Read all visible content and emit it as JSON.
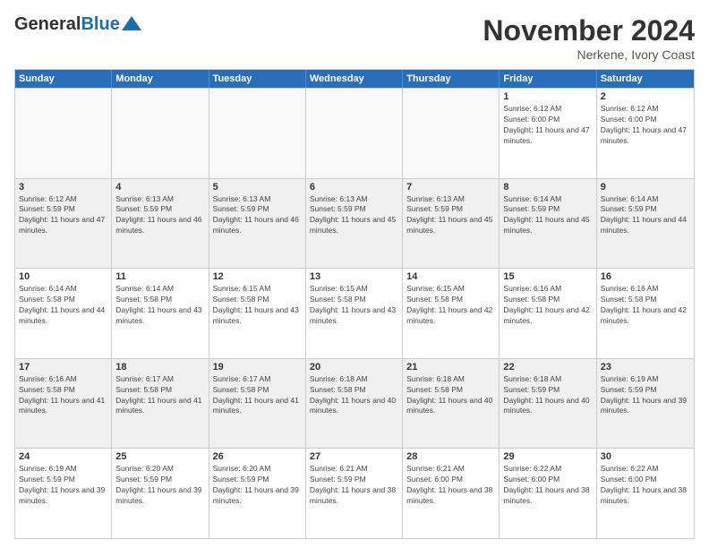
{
  "header": {
    "logo_general": "General",
    "logo_blue": "Blue",
    "month_title": "November 2024",
    "location": "Nerkene, Ivory Coast"
  },
  "days_of_week": [
    "Sunday",
    "Monday",
    "Tuesday",
    "Wednesday",
    "Thursday",
    "Friday",
    "Saturday"
  ],
  "weeks": [
    [
      {
        "day": "",
        "info": ""
      },
      {
        "day": "",
        "info": ""
      },
      {
        "day": "",
        "info": ""
      },
      {
        "day": "",
        "info": ""
      },
      {
        "day": "",
        "info": ""
      },
      {
        "day": "1",
        "info": "Sunrise: 6:12 AM\nSunset: 6:00 PM\nDaylight: 11 hours and 47 minutes."
      },
      {
        "day": "2",
        "info": "Sunrise: 6:12 AM\nSunset: 6:00 PM\nDaylight: 11 hours and 47 minutes."
      }
    ],
    [
      {
        "day": "3",
        "info": "Sunrise: 6:12 AM\nSunset: 5:59 PM\nDaylight: 11 hours and 47 minutes."
      },
      {
        "day": "4",
        "info": "Sunrise: 6:13 AM\nSunset: 5:59 PM\nDaylight: 11 hours and 46 minutes."
      },
      {
        "day": "5",
        "info": "Sunrise: 6:13 AM\nSunset: 5:59 PM\nDaylight: 11 hours and 46 minutes."
      },
      {
        "day": "6",
        "info": "Sunrise: 6:13 AM\nSunset: 5:59 PM\nDaylight: 11 hours and 45 minutes."
      },
      {
        "day": "7",
        "info": "Sunrise: 6:13 AM\nSunset: 5:59 PM\nDaylight: 11 hours and 45 minutes."
      },
      {
        "day": "8",
        "info": "Sunrise: 6:14 AM\nSunset: 5:59 PM\nDaylight: 11 hours and 45 minutes."
      },
      {
        "day": "9",
        "info": "Sunrise: 6:14 AM\nSunset: 5:59 PM\nDaylight: 11 hours and 44 minutes."
      }
    ],
    [
      {
        "day": "10",
        "info": "Sunrise: 6:14 AM\nSunset: 5:58 PM\nDaylight: 11 hours and 44 minutes."
      },
      {
        "day": "11",
        "info": "Sunrise: 6:14 AM\nSunset: 5:58 PM\nDaylight: 11 hours and 43 minutes."
      },
      {
        "day": "12",
        "info": "Sunrise: 6:15 AM\nSunset: 5:58 PM\nDaylight: 11 hours and 43 minutes."
      },
      {
        "day": "13",
        "info": "Sunrise: 6:15 AM\nSunset: 5:58 PM\nDaylight: 11 hours and 43 minutes."
      },
      {
        "day": "14",
        "info": "Sunrise: 6:15 AM\nSunset: 5:58 PM\nDaylight: 11 hours and 42 minutes."
      },
      {
        "day": "15",
        "info": "Sunrise: 6:16 AM\nSunset: 5:58 PM\nDaylight: 11 hours and 42 minutes."
      },
      {
        "day": "16",
        "info": "Sunrise: 6:16 AM\nSunset: 5:58 PM\nDaylight: 11 hours and 42 minutes."
      }
    ],
    [
      {
        "day": "17",
        "info": "Sunrise: 6:16 AM\nSunset: 5:58 PM\nDaylight: 11 hours and 41 minutes."
      },
      {
        "day": "18",
        "info": "Sunrise: 6:17 AM\nSunset: 5:58 PM\nDaylight: 11 hours and 41 minutes."
      },
      {
        "day": "19",
        "info": "Sunrise: 6:17 AM\nSunset: 5:58 PM\nDaylight: 11 hours and 41 minutes."
      },
      {
        "day": "20",
        "info": "Sunrise: 6:18 AM\nSunset: 5:58 PM\nDaylight: 11 hours and 40 minutes."
      },
      {
        "day": "21",
        "info": "Sunrise: 6:18 AM\nSunset: 5:58 PM\nDaylight: 11 hours and 40 minutes."
      },
      {
        "day": "22",
        "info": "Sunrise: 6:18 AM\nSunset: 5:59 PM\nDaylight: 11 hours and 40 minutes."
      },
      {
        "day": "23",
        "info": "Sunrise: 6:19 AM\nSunset: 5:59 PM\nDaylight: 11 hours and 39 minutes."
      }
    ],
    [
      {
        "day": "24",
        "info": "Sunrise: 6:19 AM\nSunset: 5:59 PM\nDaylight: 11 hours and 39 minutes."
      },
      {
        "day": "25",
        "info": "Sunrise: 6:20 AM\nSunset: 5:59 PM\nDaylight: 11 hours and 39 minutes."
      },
      {
        "day": "26",
        "info": "Sunrise: 6:20 AM\nSunset: 5:59 PM\nDaylight: 11 hours and 39 minutes."
      },
      {
        "day": "27",
        "info": "Sunrise: 6:21 AM\nSunset: 5:59 PM\nDaylight: 11 hours and 38 minutes."
      },
      {
        "day": "28",
        "info": "Sunrise: 6:21 AM\nSunset: 6:00 PM\nDaylight: 11 hours and 38 minutes."
      },
      {
        "day": "29",
        "info": "Sunrise: 6:22 AM\nSunset: 6:00 PM\nDaylight: 11 hours and 38 minutes."
      },
      {
        "day": "30",
        "info": "Sunrise: 6:22 AM\nSunset: 6:00 PM\nDaylight: 11 hours and 38 minutes."
      }
    ]
  ]
}
